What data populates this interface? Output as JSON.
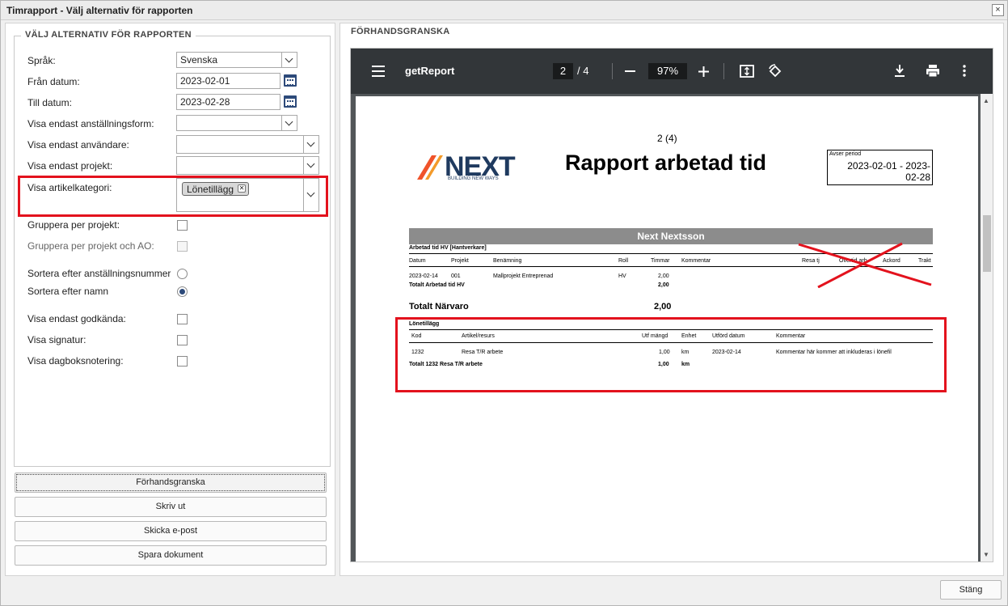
{
  "window": {
    "title": "Timrapport - Välj alternativ för rapporten",
    "close_glyph": "×"
  },
  "left": {
    "legend": "VÄLJ ALTERNATIV FÖR RAPPORTEN",
    "language_label": "Språk:",
    "language_value": "Svenska",
    "from_label": "Från datum:",
    "from_value": "2023-02-01",
    "to_label": "Till datum:",
    "to_value": "2023-02-28",
    "employment_label": "Visa endast anställningsform:",
    "users_label": "Visa endast användare:",
    "projects_label": "Visa endast projekt:",
    "category_label": "Visa artikelkategori:",
    "category_tag": "Lönetillägg",
    "group_project_label": "Gruppera per projekt:",
    "group_project_ao_label": "Gruppera per projekt och AO:",
    "sort_employee_label": "Sortera efter anställningsnummer",
    "sort_name_label": "Sortera efter namn",
    "approved_label": "Visa endast godkända:",
    "signature_label": "Visa signatur:",
    "diary_label": "Visa dagboksnotering:"
  },
  "buttons": {
    "preview": "Förhandsgranska",
    "print": "Skriv ut",
    "email": "Skicka e-post",
    "save": "Spara dokument",
    "close": "Stäng"
  },
  "right": {
    "legend": "FÖRHANDSGRANSKA",
    "toolbar": {
      "doc_title": "getReport",
      "page_current": "2",
      "page_total": "/  4",
      "zoom": "97%"
    },
    "report": {
      "page_label": "2 (4)",
      "logo_text": "NEXT",
      "logo_tagline": "BUILDING NEW WAYS",
      "title": "Rapport arbetad tid",
      "period_label": "Avser period",
      "period_line1": "2023-02-01 - 2023-",
      "period_line2": "02-28",
      "employee": "Next Nextsson",
      "section1_title": "Arbetad tid HV [Hantverkare]",
      "section1_headers": [
        "Datum",
        "Projekt",
        "Benämning",
        "Roll",
        "Timmar",
        "Kommentar",
        "Resa tj",
        "Övertid arb",
        "Ackord",
        "Trakt"
      ],
      "section1_row": [
        "2023-02-14",
        "001",
        "Mallprojekt Entreprenad",
        "HV",
        "2,00"
      ],
      "section1_total_label": "Totalt Arbetad tid HV",
      "section1_total_value": "2,00",
      "presence_label": "Totalt Närvaro",
      "presence_value": "2,00",
      "section2_title": "Lönetillägg",
      "section2_headers": [
        "Kod",
        "Artikel/resurs",
        "Utf mängd",
        "Enhet",
        "Utförd datum",
        "Kommentar"
      ],
      "section2_row": [
        "1232",
        "Resa T/R arbete",
        "1,00",
        "km",
        "2023-02-14",
        "Kommentar här kommer att inkluderas i lönefil"
      ],
      "section2_total_label": "Totalt 1232 Resa T/R arbete",
      "section2_total_value": "1,00",
      "section2_total_unit": "km"
    }
  },
  "colors": {
    "highlight": "#e3121d",
    "toolbar": "#323639",
    "logo_accent": "#f0532a",
    "logo_dark": "#1f3a5f"
  }
}
